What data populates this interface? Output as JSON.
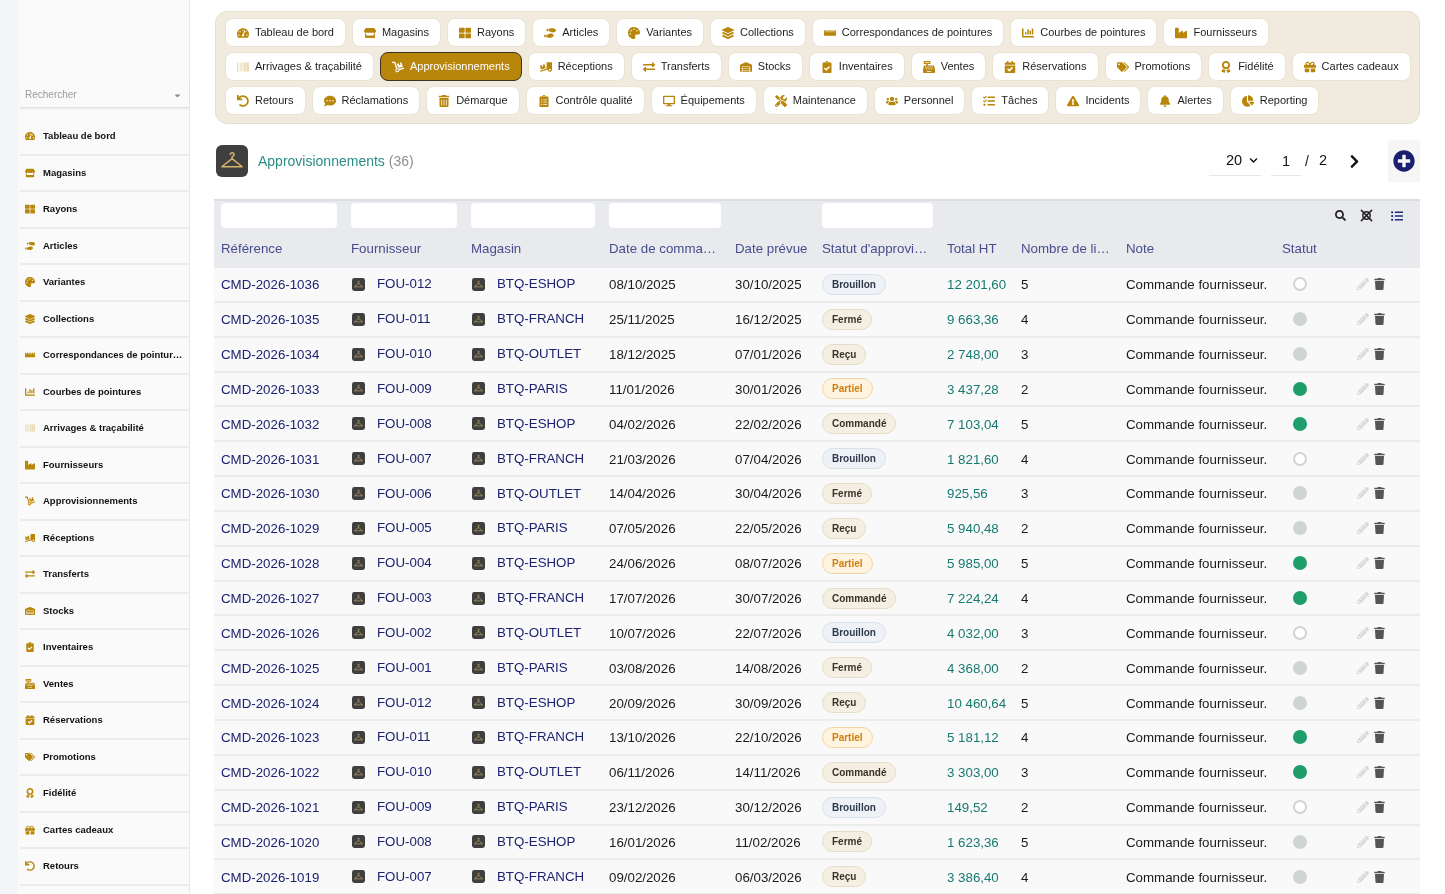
{
  "sidebar": {
    "search": {
      "placeholder": "Rechercher"
    },
    "items": [
      "Tableau de bord",
      "Magasins",
      "Rayons",
      "Articles",
      "Variantes",
      "Collections",
      "Correspondances de pointur…",
      "Courbes de pointures",
      "Arrivages & traçabilité",
      "Fournisseurs",
      "Approvisionnements",
      "Réceptions",
      "Transferts",
      "Stocks",
      "Inventaires",
      "Ventes",
      "Réservations",
      "Promotions",
      "Fidélité",
      "Cartes cadeaux",
      "Retours"
    ]
  },
  "nav": {
    "items": [
      {
        "label": "Tableau de bord",
        "selected": false
      },
      {
        "label": "Magasins",
        "selected": false
      },
      {
        "label": "Rayons",
        "selected": false
      },
      {
        "label": "Articles",
        "selected": false
      },
      {
        "label": "Variantes",
        "selected": false
      },
      {
        "label": "Collections",
        "selected": false
      },
      {
        "label": "Correspondances de pointures",
        "selected": false
      },
      {
        "label": "Courbes de pointures",
        "selected": false
      },
      {
        "label": "Fournisseurs",
        "selected": false
      },
      {
        "label": "Arrivages & traçabilité",
        "selected": false
      },
      {
        "label": "Approvisionnements",
        "selected": true
      },
      {
        "label": "Réceptions",
        "selected": false
      },
      {
        "label": "Transferts",
        "selected": false
      },
      {
        "label": "Stocks",
        "selected": false
      },
      {
        "label": "Inventaires",
        "selected": false
      },
      {
        "label": "Ventes",
        "selected": false
      },
      {
        "label": "Réservations",
        "selected": false
      },
      {
        "label": "Promotions",
        "selected": false
      },
      {
        "label": "Fidélité",
        "selected": false
      },
      {
        "label": "Cartes cadeaux",
        "selected": false
      },
      {
        "label": "Retours",
        "selected": false
      },
      {
        "label": "Réclamations",
        "selected": false
      },
      {
        "label": "Démarque",
        "selected": false
      },
      {
        "label": "Contrôle qualité",
        "selected": false
      },
      {
        "label": "Équipements",
        "selected": false
      },
      {
        "label": "Maintenance",
        "selected": false
      },
      {
        "label": "Personnel",
        "selected": false
      },
      {
        "label": "Tâches",
        "selected": false
      },
      {
        "label": "Incidents",
        "selected": false
      },
      {
        "label": "Alertes",
        "selected": false
      },
      {
        "label": "Reporting",
        "selected": false
      }
    ]
  },
  "page": {
    "title": "Approvisionnements",
    "count": "(36)"
  },
  "pagination": {
    "page_size": "20",
    "page": "1",
    "separator": "/",
    "pages": "2"
  },
  "table": {
    "columns": [
      {
        "label": "Référence",
        "filter": true
      },
      {
        "label": "Fournisseur",
        "filter": true
      },
      {
        "label": "Magasin",
        "filter": true
      },
      {
        "label": "Date de comma…",
        "filter": true
      },
      {
        "label": "Date prévue",
        "filter": false
      },
      {
        "label": "Statut d'approvi…",
        "filter": true
      },
      {
        "label": "Total HT",
        "filter": false
      },
      {
        "label": "Nombre de li…",
        "filter": false
      },
      {
        "label": "Note",
        "filter": false
      },
      {
        "label": "Statut",
        "filter": false
      }
    ],
    "rows": [
      {
        "reference": "CMD-2026-1036",
        "supplier": "FOU-012",
        "store": "BTQ-ESHOP",
        "order_date": "08/10/2025",
        "expected_date": "30/10/2025",
        "approval_status": {
          "label": "Brouillon",
          "kind": "slate"
        },
        "total": "12 201,60",
        "line_count": "5",
        "note": "Commande fournisseur.",
        "status": {
          "kind": "ring"
        }
      },
      {
        "reference": "CMD-2026-1035",
        "supplier": "FOU-011",
        "store": "BTQ-FRANCH",
        "order_date": "25/11/2025",
        "expected_date": "16/12/2025",
        "approval_status": {
          "label": "Fermé",
          "kind": "sand"
        },
        "total": "9 663,36",
        "line_count": "4",
        "note": "Commande fournisseur.",
        "status": {
          "kind": "dot",
          "color": "#cfd5d4"
        }
      },
      {
        "reference": "CMD-2026-1034",
        "supplier": "FOU-010",
        "store": "BTQ-OUTLET",
        "order_date": "18/12/2025",
        "expected_date": "07/01/2026",
        "approval_status": {
          "label": "Reçu",
          "kind": "sand"
        },
        "total": "2 748,00",
        "line_count": "3",
        "note": "Commande fournisseur.",
        "status": {
          "kind": "dot",
          "color": "#cfd5d4"
        }
      },
      {
        "reference": "CMD-2026-1033",
        "supplier": "FOU-009",
        "store": "BTQ-PARIS",
        "order_date": "11/01/2026",
        "expected_date": "30/01/2026",
        "approval_status": {
          "label": "Partiel",
          "kind": "amber"
        },
        "total": "3 437,28",
        "line_count": "2",
        "note": "Commande fournisseur.",
        "status": {
          "kind": "dot",
          "color": "#1f9d6b"
        }
      },
      {
        "reference": "CMD-2026-1032",
        "supplier": "FOU-008",
        "store": "BTQ-ESHOP",
        "order_date": "04/02/2026",
        "expected_date": "22/02/2026",
        "approval_status": {
          "label": "Commandé",
          "kind": "sand"
        },
        "total": "7 103,04",
        "line_count": "5",
        "note": "Commande fournisseur.",
        "status": {
          "kind": "dot",
          "color": "#1f9d6b"
        }
      },
      {
        "reference": "CMD-2026-1031",
        "supplier": "FOU-007",
        "store": "BTQ-FRANCH",
        "order_date": "21/03/2026",
        "expected_date": "07/04/2026",
        "approval_status": {
          "label": "Brouillon",
          "kind": "slate"
        },
        "total": "1 821,60",
        "line_count": "4",
        "note": "Commande fournisseur.",
        "status": {
          "kind": "ring"
        }
      },
      {
        "reference": "CMD-2026-1030",
        "supplier": "FOU-006",
        "store": "BTQ-OUTLET",
        "order_date": "14/04/2026",
        "expected_date": "30/04/2026",
        "approval_status": {
          "label": "Fermé",
          "kind": "sand"
        },
        "total": "925,56",
        "line_count": "3",
        "note": "Commande fournisseur.",
        "status": {
          "kind": "dot",
          "color": "#cfd5d4"
        }
      },
      {
        "reference": "CMD-2026-1029",
        "supplier": "FOU-005",
        "store": "BTQ-PARIS",
        "order_date": "07/05/2026",
        "expected_date": "22/05/2026",
        "approval_status": {
          "label": "Reçu",
          "kind": "sand"
        },
        "total": "5 940,48",
        "line_count": "2",
        "note": "Commande fournisseur.",
        "status": {
          "kind": "dot",
          "color": "#cfd5d4"
        }
      },
      {
        "reference": "CMD-2026-1028",
        "supplier": "FOU-004",
        "store": "BTQ-ESHOP",
        "order_date": "24/06/2026",
        "expected_date": "08/07/2026",
        "approval_status": {
          "label": "Partiel",
          "kind": "amber"
        },
        "total": "5 985,00",
        "line_count": "5",
        "note": "Commande fournisseur.",
        "status": {
          "kind": "dot",
          "color": "#1f9d6b"
        }
      },
      {
        "reference": "CMD-2026-1027",
        "supplier": "FOU-003",
        "store": "BTQ-FRANCH",
        "order_date": "17/07/2026",
        "expected_date": "30/07/2026",
        "approval_status": {
          "label": "Commandé",
          "kind": "sand"
        },
        "total": "7 224,24",
        "line_count": "4",
        "note": "Commande fournisseur.",
        "status": {
          "kind": "dot",
          "color": "#1f9d6b"
        }
      },
      {
        "reference": "CMD-2026-1026",
        "supplier": "FOU-002",
        "store": "BTQ-OUTLET",
        "order_date": "10/07/2026",
        "expected_date": "22/07/2026",
        "approval_status": {
          "label": "Brouillon",
          "kind": "slate"
        },
        "total": "4 032,00",
        "line_count": "3",
        "note": "Commande fournisseur.",
        "status": {
          "kind": "ring"
        }
      },
      {
        "reference": "CMD-2026-1025",
        "supplier": "FOU-001",
        "store": "BTQ-PARIS",
        "order_date": "03/08/2026",
        "expected_date": "14/08/2026",
        "approval_status": {
          "label": "Fermé",
          "kind": "sand"
        },
        "total": "4 368,00",
        "line_count": "2",
        "note": "Commande fournisseur.",
        "status": {
          "kind": "dot",
          "color": "#cfd5d4"
        }
      },
      {
        "reference": "CMD-2026-1024",
        "supplier": "FOU-012",
        "store": "BTQ-ESHOP",
        "order_date": "20/09/2026",
        "expected_date": "30/09/2026",
        "approval_status": {
          "label": "Reçu",
          "kind": "sand"
        },
        "total": "10 460,64",
        "line_count": "5",
        "note": "Commande fournisseur.",
        "status": {
          "kind": "dot",
          "color": "#cfd5d4"
        }
      },
      {
        "reference": "CMD-2026-1023",
        "supplier": "FOU-011",
        "store": "BTQ-FRANCH",
        "order_date": "13/10/2026",
        "expected_date": "22/10/2026",
        "approval_status": {
          "label": "Partiel",
          "kind": "amber"
        },
        "total": "5 181,12",
        "line_count": "4",
        "note": "Commande fournisseur.",
        "status": {
          "kind": "dot",
          "color": "#1f9d6b"
        }
      },
      {
        "reference": "CMD-2026-1022",
        "supplier": "FOU-010",
        "store": "BTQ-OUTLET",
        "order_date": "06/11/2026",
        "expected_date": "14/11/2026",
        "approval_status": {
          "label": "Commandé",
          "kind": "sand"
        },
        "total": "3 303,00",
        "line_count": "3",
        "note": "Commande fournisseur.",
        "status": {
          "kind": "dot",
          "color": "#1f9d6b"
        }
      },
      {
        "reference": "CMD-2026-1021",
        "supplier": "FOU-009",
        "store": "BTQ-PARIS",
        "order_date": "23/12/2026",
        "expected_date": "30/12/2026",
        "approval_status": {
          "label": "Brouillon",
          "kind": "slate"
        },
        "total": "149,52",
        "line_count": "2",
        "note": "Commande fournisseur.",
        "status": {
          "kind": "ring"
        }
      },
      {
        "reference": "CMD-2026-1020",
        "supplier": "FOU-008",
        "store": "BTQ-ESHOP",
        "order_date": "16/01/2026",
        "expected_date": "11/02/2026",
        "approval_status": {
          "label": "Fermé",
          "kind": "sand"
        },
        "total": "1 623,36",
        "line_count": "5",
        "note": "Commande fournisseur.",
        "status": {
          "kind": "dot",
          "color": "#cfd5d4"
        }
      },
      {
        "reference": "CMD-2026-1019",
        "supplier": "FOU-007",
        "store": "BTQ-FRANCH",
        "order_date": "09/02/2026",
        "expected_date": "06/03/2026",
        "approval_status": {
          "label": "Reçu",
          "kind": "sand"
        },
        "total": "3 386,40",
        "line_count": "4",
        "note": "Commande fournisseur.",
        "status": {
          "kind": "dot",
          "color": "#cfd5d4"
        }
      }
    ]
  }
}
